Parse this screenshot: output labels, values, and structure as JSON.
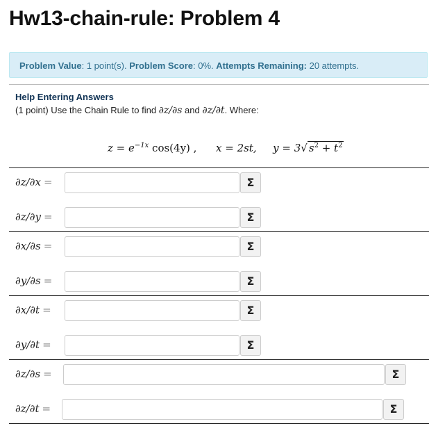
{
  "title": "Hw13-chain-rule: Problem 4",
  "info": {
    "value_label": "Problem Value",
    "value_text": ": 1 point(s). ",
    "score_label": "Problem Score",
    "score_text": ": 0%. ",
    "attempts_label": "Attempts Remaining:",
    "attempts_text": " 20 attempts."
  },
  "help_link": "Help Entering Answers",
  "prompt": {
    "prefix": "(1 point) Use the Chain Rule to find ",
    "d1": "∂z/∂s",
    "and": " and ",
    "d2": "∂z/∂t",
    "suffix": ". Where:"
  },
  "formula": {
    "z_part": "z = e",
    "z_exp": "−1x",
    "z_rest": " cos(4y) ,",
    "x_part": "x = 2st,",
    "y_part": "y = 3",
    "y_sqrt_s": "s",
    "y_sqrt_plus": " + ",
    "y_sqrt_t": "t",
    "sq": "2"
  },
  "rows": [
    {
      "label": "∂z/∂x",
      "value": ""
    },
    {
      "label": "∂z/∂y",
      "value": ""
    },
    {
      "label": "∂x/∂s",
      "value": ""
    },
    {
      "label": "∂y/∂s",
      "value": ""
    },
    {
      "label": "∂x/∂t",
      "value": ""
    },
    {
      "label": "∂y/∂t",
      "value": ""
    },
    {
      "label": "∂z/∂s",
      "value": ""
    },
    {
      "label": "∂z/∂t",
      "value": ""
    }
  ],
  "equals": "=",
  "sigma": "Σ",
  "icons": {
    "equation_editor": "sigma-icon"
  }
}
